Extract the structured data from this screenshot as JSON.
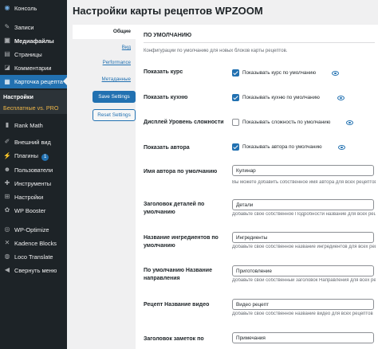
{
  "sidebar": {
    "menu": [
      {
        "label": "Консоль",
        "icon": "dashboard-icon"
      },
      {
        "label": "Записи",
        "icon": "pin-icon"
      },
      {
        "label": "Медиафайлы",
        "icon": "media-icon"
      },
      {
        "label": "Страницы",
        "icon": "page-icon"
      },
      {
        "label": "Комментарии",
        "icon": "comment-icon"
      },
      {
        "label": "Карточка рецепта",
        "icon": "recipe-card-icon"
      }
    ],
    "submenu": [
      {
        "label": "Настройки"
      },
      {
        "label": "Бесплатные vs. PRO"
      }
    ],
    "menu2": [
      {
        "label": "Rank Math",
        "icon": "chart-icon"
      },
      {
        "label": "Внешний вид",
        "icon": "brush-icon"
      },
      {
        "label": "Плагины",
        "icon": "plugin-icon",
        "badge": "1"
      },
      {
        "label": "Пользователи",
        "icon": "users-icon"
      },
      {
        "label": "Инструменты",
        "icon": "wrench-icon"
      },
      {
        "label": "Настройки",
        "icon": "settings-icon"
      },
      {
        "label": "WP Booster",
        "icon": "booster-icon"
      },
      {
        "label": "WP-Optimize",
        "icon": "optimize-icon"
      },
      {
        "label": "Kadence Blocks",
        "icon": "kadence-icon"
      },
      {
        "label": "Loco Translate",
        "icon": "translate-icon"
      },
      {
        "label": "Свернуть меню",
        "icon": "collapse-icon"
      }
    ],
    "colors": {
      "bg": "#1d2327",
      "active": "#2271b1",
      "submenu_bg": "#2c3338",
      "sub_active": "#ffffff",
      "sub_link": "#f0b849"
    }
  },
  "page": {
    "title": "Настройки карты рецептов WPZOOM"
  },
  "tabs": {
    "active": "Общие",
    "links": [
      "Вид",
      "Performance",
      "Метаданные"
    ],
    "save_label": "Save Settings",
    "reset_label": "Reset Settings"
  },
  "section": {
    "title": "ПО УМОЛЧАНИЮ",
    "description": "Конфигурации по умолчанию для новых блоков карты рецептов."
  },
  "checkbox_rows": [
    {
      "label": "Показать курс",
      "option": "Показывать курс по умолчанию",
      "checked": true
    },
    {
      "label": "Показать кухню",
      "option": "Показывать кухню по умолчанию",
      "checked": true
    },
    {
      "label": "Дисплей Уровень сложности",
      "option": "Показывать сложность по умолчанию",
      "checked": false
    },
    {
      "label": "Показать автора",
      "option": "Показывать автора по умолчанию",
      "checked": true
    }
  ],
  "text_rows": [
    {
      "label": "Имя автора по умолчанию",
      "value": "Кулинар",
      "desc": "Вы можете добавить собственное имя автора для всех рецептов"
    },
    {
      "label": "Заголовок деталей по умолчанию",
      "value": "Детали",
      "desc": "Добавьте свое собственное Подробности название для всех рецептов"
    },
    {
      "label": "Название ингредиентов по умолчанию",
      "value": "Ингредиенты",
      "desc": "Добавьте свое собственное название ингредиентов для всех рецептов"
    },
    {
      "label": "По умолчанию Название направления",
      "value": "Приготовление",
      "desc": "Добавьте свой собственный заголовок Направления для всех рецептов"
    },
    {
      "label": "Рецепт Название видео",
      "value": "Видео рецепт",
      "desc": "Добавьте свое собственное название видео для всех рецептов"
    },
    {
      "label": "Заголовок заметок по",
      "value": "Примечания",
      "desc": ""
    }
  ],
  "colors": {
    "accent": "#2271b1",
    "page_bg": "#f0f0f1",
    "card_bg": "#ffffff"
  }
}
